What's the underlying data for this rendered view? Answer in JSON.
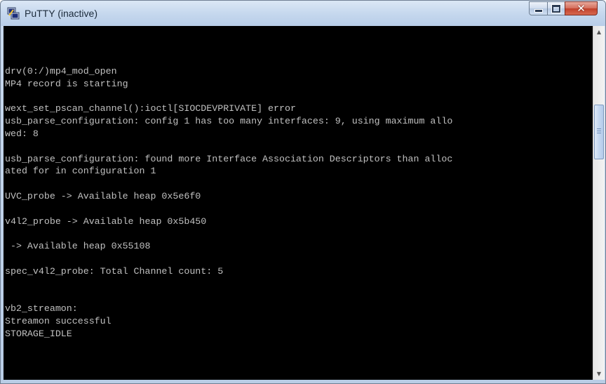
{
  "window": {
    "title": "PuTTY (inactive)",
    "icon": "putty-icon"
  },
  "caption_buttons": {
    "minimize_icon": "minimize-icon",
    "maximize_icon": "maximize-icon",
    "close_icon": "close-icon"
  },
  "terminal": {
    "background": "#000000",
    "foreground": "#c0c0c0",
    "lines": [
      "drv(0:/)mp4_mod_open",
      "MP4 record is starting",
      "",
      "wext_set_pscan_channel():ioctl[SIOCDEVPRIVATE] error",
      "usb_parse_configuration: config 1 has too many interfaces: 9, using maximum allo",
      "wed: 8",
      "",
      "usb_parse_configuration: found more Interface Association Descriptors than alloc",
      "ated for in configuration 1",
      "",
      "UVC_probe -> Available heap 0x5e6f0",
      "",
      "v4l2_probe -> Available heap 0x5b450",
      "",
      " -> Available heap 0x55108",
      "",
      "spec_v4l2_probe: Total Channel count: 5",
      "",
      "",
      "vb2_streamon:",
      "Streamon successful",
      "STORAGE_IDLE"
    ]
  },
  "scrollbar": {
    "up_arrow_icon": "scroll-up-arrow-icon",
    "down_arrow_icon": "scroll-down-arrow-icon"
  }
}
